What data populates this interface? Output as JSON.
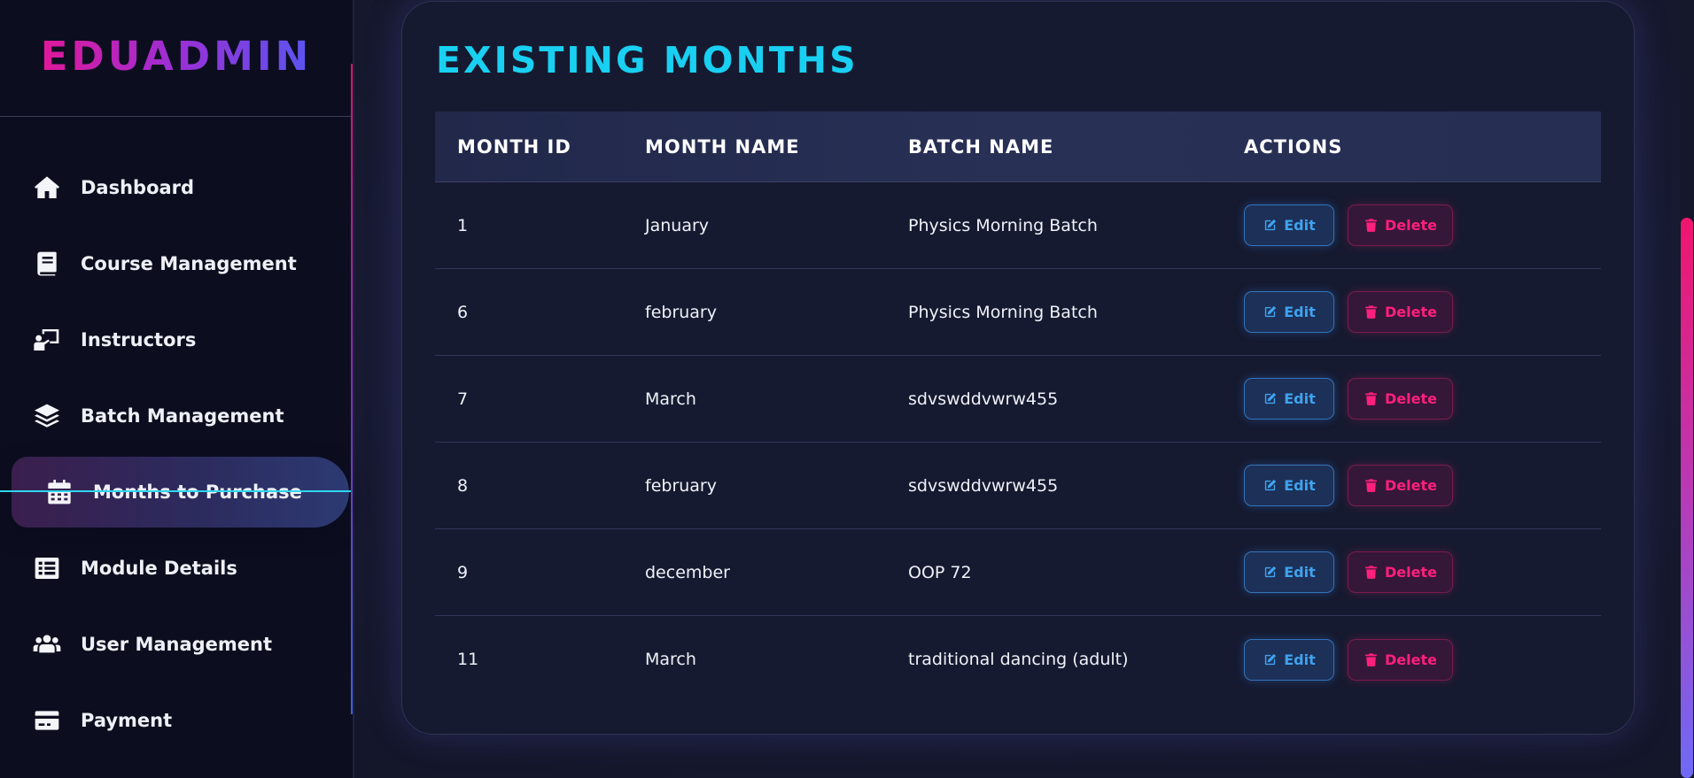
{
  "brand": {
    "title": "EDUADMIN"
  },
  "sidebar": {
    "items": [
      {
        "label": "Dashboard",
        "icon": "home-icon",
        "active": false
      },
      {
        "label": "Course Management",
        "icon": "book-icon",
        "active": false
      },
      {
        "label": "Instructors",
        "icon": "chalkboard-teacher-icon",
        "active": false
      },
      {
        "label": "Batch Management",
        "icon": "layers-icon",
        "active": false
      },
      {
        "label": "Months to Purchase",
        "icon": "calendar-icon",
        "active": true
      },
      {
        "label": "Module Details",
        "icon": "list-icon",
        "active": false
      },
      {
        "label": "User Management",
        "icon": "users-icon",
        "active": false
      },
      {
        "label": "Payment",
        "icon": "credit-card-icon",
        "active": false
      }
    ]
  },
  "main": {
    "title": "EXISTING MONTHS",
    "table": {
      "columns": [
        "MONTH ID",
        "MONTH NAME",
        "BATCH NAME",
        "ACTIONS"
      ],
      "rows": [
        {
          "id": "1",
          "month": "January",
          "batch": "Physics Morning Batch"
        },
        {
          "id": "6",
          "month": "february",
          "batch": "Physics Morning Batch"
        },
        {
          "id": "7",
          "month": "March",
          "batch": "sdvswddvwrw455"
        },
        {
          "id": "8",
          "month": "february",
          "batch": "sdvswddvwrw455"
        },
        {
          "id": "9",
          "month": "december",
          "batch": "OOP 72"
        },
        {
          "id": "11",
          "month": "March",
          "batch": "traditional dancing (adult)"
        }
      ],
      "actions": {
        "edit_label": "Edit",
        "delete_label": "Delete"
      }
    }
  },
  "colors": {
    "accent_cyan": "#19d0f2",
    "edit_blue": "#3fa3ef",
    "delete_pink": "#ff1f7c",
    "sidebar_bg": "#0c0e1f"
  }
}
